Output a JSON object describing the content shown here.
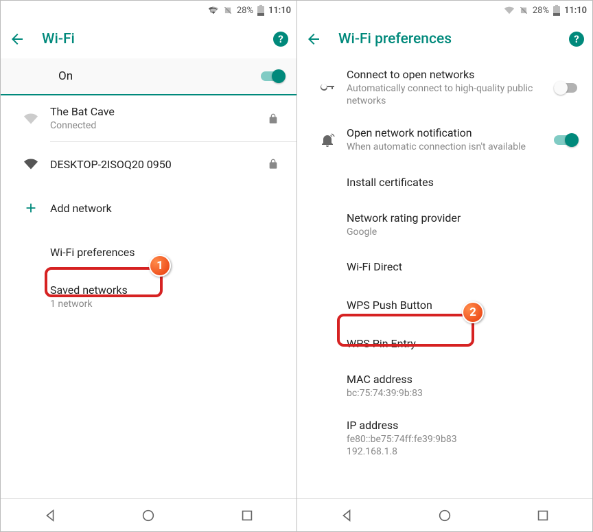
{
  "status": {
    "battery_pct": "28%",
    "time": "11:10"
  },
  "left": {
    "appbar_title": "Wi-Fi",
    "switch_label": "On",
    "networks": [
      {
        "name": "The Bat Cave",
        "status": "Connected",
        "locked": true,
        "signal_on": false
      },
      {
        "name": "DESKTOP-2ISOQ20 0950",
        "status": "",
        "locked": true,
        "signal_on": true
      }
    ],
    "add_network": "Add network",
    "links": {
      "prefs": "Wi-Fi preferences",
      "saved_title": "Saved networks",
      "saved_sub": "1 network"
    }
  },
  "right": {
    "appbar_title": "Wi-Fi preferences",
    "items": {
      "open_title": "Connect to open networks",
      "open_sub": "Automatically connect to high-quality public networks",
      "notif_title": "Open network notification",
      "notif_sub": "When automatic connection isn't available",
      "install_cert": "Install certificates",
      "rating_title": "Network rating provider",
      "rating_sub": "Google",
      "wifi_direct": "Wi-Fi Direct",
      "wps_push": "WPS Push Button",
      "wps_pin": "WPS Pin Entry",
      "mac_title": "MAC address",
      "mac_sub": "bc:75:74:39:9b:83",
      "ip_title": "IP address",
      "ip_sub": "fe80::be75:74ff:fe39:9b83\n192.168.1.8"
    }
  },
  "callouts": {
    "one": "1",
    "two": "2"
  }
}
